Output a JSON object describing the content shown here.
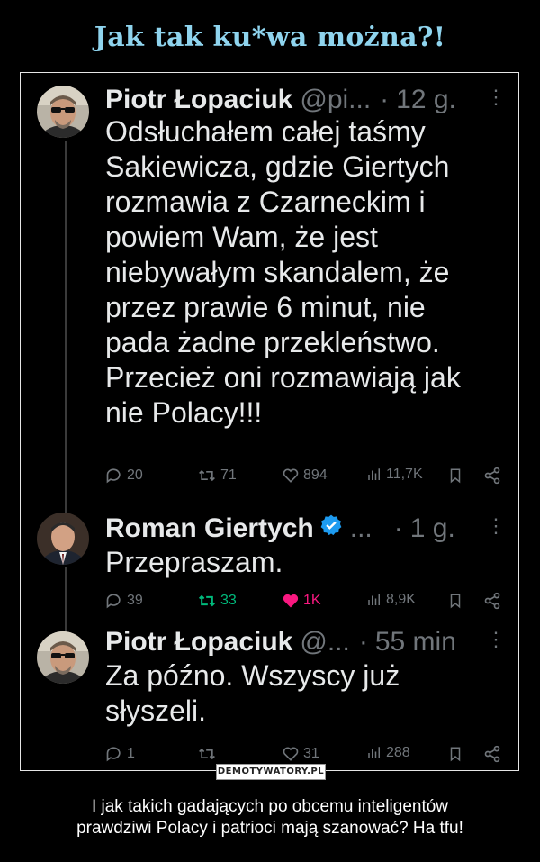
{
  "meme": {
    "title": "Jak tak ku*wa można?!",
    "caption_line1": "I jak takich gadających po obcemu inteligentów",
    "caption_line2": "prawdziwi Polacy i patrioci mają szanować? Ha tfu!",
    "stamp": "DEMOTYWATORY.PL"
  },
  "tweets": [
    {
      "name": "Piotr Łopaciuk",
      "handle": "@pi...",
      "dot": "·",
      "time": "12 g.",
      "more": "⋮",
      "verified": false,
      "lines": [
        "Odsłuchałem całej taśmy",
        "Sakiewicza, gdzie Giertych",
        "rozmawia z Czarneckim i",
        "powiem Wam, że jest",
        "niebywałym skandalem, że",
        "przez prawie 6 minut, nie",
        "pada żadne przekleństwo.",
        "Przecież oni rozmawiają jak",
        "nie Polacy!!!"
      ],
      "replies": "20",
      "retweets": "71",
      "likes": "894",
      "views": "11,7K",
      "liked": false,
      "retweeted": false
    },
    {
      "name": "Roman Giertych",
      "handle": "...",
      "dot": "·",
      "time": "1 g.",
      "more": "⋮",
      "verified": true,
      "lines": [
        "Przepraszam."
      ],
      "replies": "39",
      "retweets": "33",
      "likes": "1K",
      "views": "8,9K",
      "liked": true,
      "retweeted": true
    },
    {
      "name": "Piotr Łopaciuk",
      "handle": "@...",
      "dot": "·",
      "time": "55 min",
      "more": "⋮",
      "verified": false,
      "lines": [
        "Za późno. Wszyscy już",
        "słyszeli."
      ],
      "replies": "1",
      "retweets": "",
      "likes": "31",
      "views": "288",
      "liked": false,
      "retweeted": false
    }
  ],
  "colors": {
    "title": "#8fd4ee",
    "muted": "#71767b",
    "like": "#f91880",
    "retweet": "#00ba7c",
    "verified": "#1d9bf0"
  }
}
